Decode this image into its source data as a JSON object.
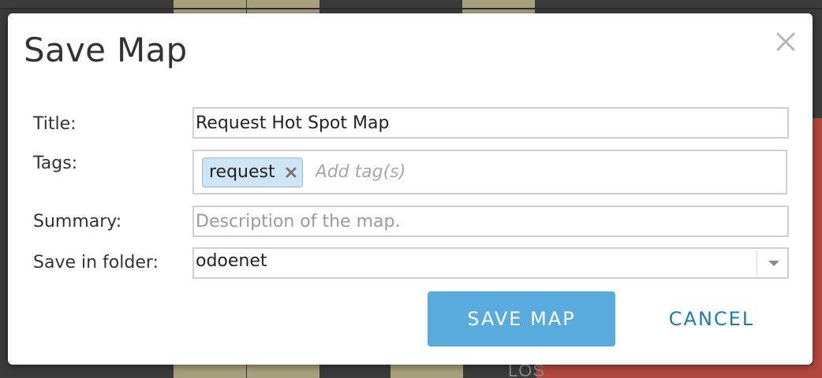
{
  "background": {
    "map_label": "LOS",
    "colors": {
      "map_base": "#3b3b3b",
      "block": "#a7a07d",
      "red_region": "#b2473d"
    }
  },
  "dialog": {
    "title": "Save Map",
    "close_icon": "close-icon",
    "fields": {
      "title_label": "Title:",
      "title_value": "Request Hot Spot Map",
      "tags_label": "Tags:",
      "tags": [
        {
          "label": "request",
          "remove_icon": "close-icon"
        }
      ],
      "tags_placeholder": "Add tag(s)",
      "summary_label": "Summary:",
      "summary_placeholder": "Description of the map.",
      "folder_label": "Save in folder:",
      "folder_value": "odoenet",
      "folder_icon": "chevron-down-icon"
    },
    "buttons": {
      "save_label": "SAVE MAP",
      "cancel_label": "CANCEL"
    },
    "colors": {
      "primary_button": "#5aabdd",
      "link_button": "#1f7ab8",
      "tag_chip_bg": "#cfe5f5"
    }
  }
}
